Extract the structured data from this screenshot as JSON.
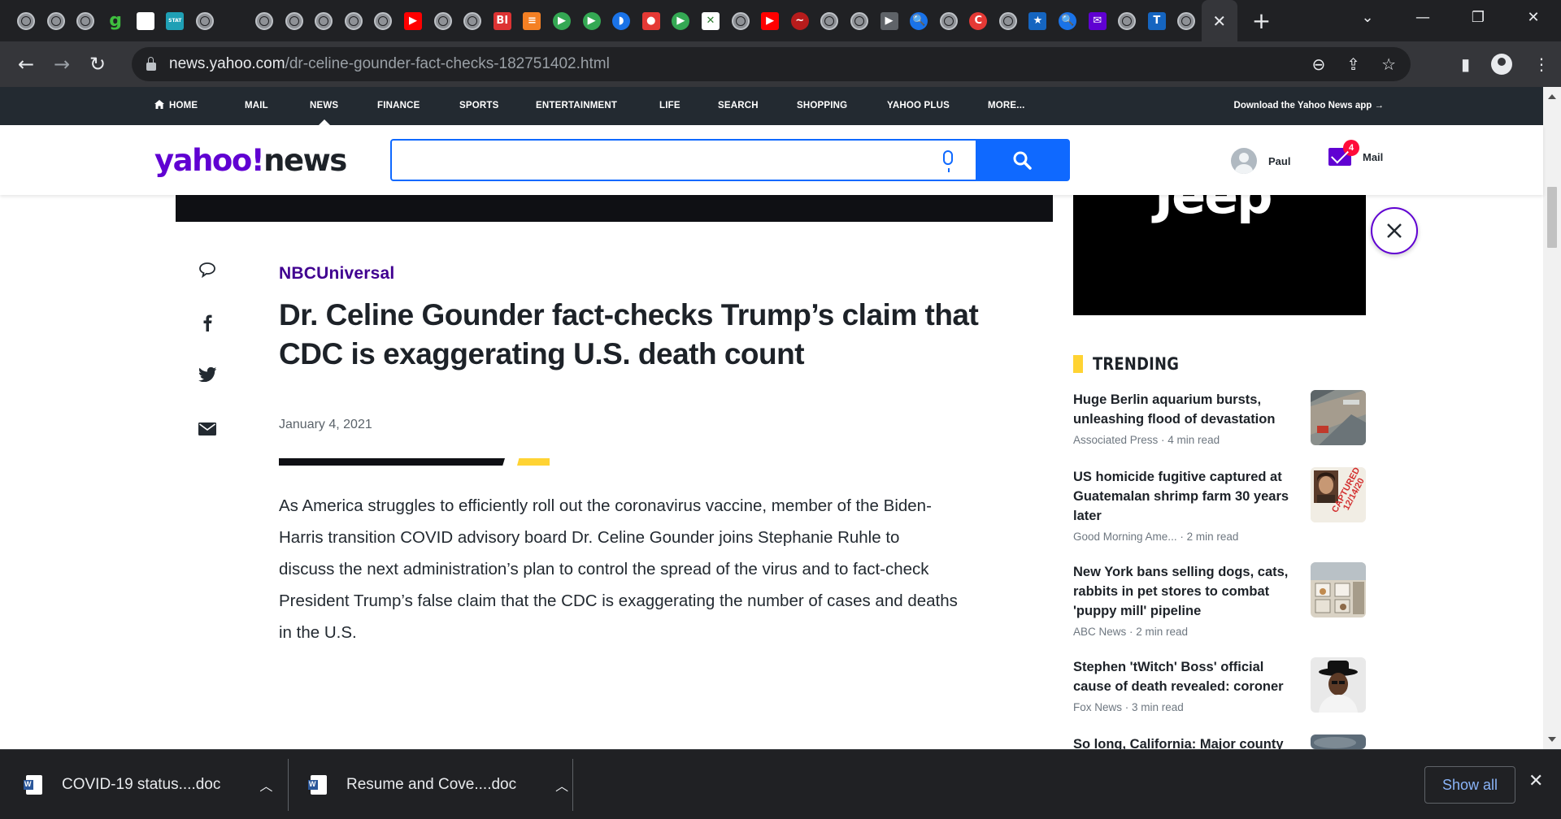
{
  "browser": {
    "tabs": [
      {
        "icon": "globe-icon",
        "kind": "globe"
      },
      {
        "icon": "globe-icon",
        "kind": "globe"
      },
      {
        "icon": "globe-icon",
        "kind": "globe"
      },
      {
        "icon": "g-icon",
        "kind": "letter",
        "glyph": "g",
        "color": "#3fbf3f"
      },
      {
        "icon": "white-square-icon",
        "kind": "square",
        "color": "#ffffff"
      },
      {
        "icon": "stat-icon",
        "kind": "square",
        "color": "#1fa0b5",
        "glyph": "STAT"
      },
      {
        "icon": "globe-icon",
        "kind": "globe"
      },
      {
        "icon": "blank-icon",
        "kind": "blank"
      },
      {
        "icon": "globe-icon",
        "kind": "globe"
      },
      {
        "icon": "globe-icon",
        "kind": "globe"
      },
      {
        "icon": "globe-icon",
        "kind": "globe"
      },
      {
        "icon": "globe-icon",
        "kind": "globe"
      },
      {
        "icon": "globe-icon",
        "kind": "globe"
      },
      {
        "icon": "youtube-icon",
        "kind": "square",
        "color": "#ff0000",
        "glyph": "▶"
      },
      {
        "icon": "globe-icon",
        "kind": "globe"
      },
      {
        "icon": "globe-icon",
        "kind": "globe"
      },
      {
        "icon": "business-insider-icon",
        "kind": "square",
        "color": "#d33",
        "glyph": "BI"
      },
      {
        "icon": "stack-icon",
        "kind": "square",
        "color": "#f48024",
        "glyph": "≡"
      },
      {
        "icon": "play-green-icon",
        "kind": "circle",
        "color": "#34a853",
        "glyph": "▶"
      },
      {
        "icon": "play-green-icon",
        "kind": "circle",
        "color": "#34a853",
        "glyph": "▶"
      },
      {
        "icon": "shield-icon",
        "kind": "circle",
        "color": "#1a73e8",
        "glyph": "◗"
      },
      {
        "icon": "mic-red-icon",
        "kind": "square",
        "color": "#e53935",
        "glyph": "●"
      },
      {
        "icon": "play-green-icon",
        "kind": "circle",
        "color": "#34a853",
        "glyph": "▶"
      },
      {
        "icon": "grid-icon",
        "kind": "square",
        "color": "#ffffff",
        "glyph": "✕"
      },
      {
        "icon": "globe-icon",
        "kind": "globe"
      },
      {
        "icon": "youtube-icon",
        "kind": "square",
        "color": "#ff0000",
        "glyph": "▶"
      },
      {
        "icon": "scribble-icon",
        "kind": "circle",
        "color": "#b71c1c",
        "glyph": "~"
      },
      {
        "icon": "globe-icon",
        "kind": "globe"
      },
      {
        "icon": "globe-icon",
        "kind": "globe"
      },
      {
        "icon": "arrow-badge-icon",
        "kind": "square",
        "color": "#5f6368",
        "glyph": "▶"
      },
      {
        "icon": "search-blue-icon",
        "kind": "circle",
        "color": "#1a73e8",
        "glyph": "🔍"
      },
      {
        "icon": "globe-icon",
        "kind": "globe"
      },
      {
        "icon": "c-red-icon",
        "kind": "circle",
        "color": "#e53935",
        "glyph": "C"
      },
      {
        "icon": "globe-icon",
        "kind": "globe"
      },
      {
        "icon": "flag-icon",
        "kind": "square",
        "color": "#1565c0",
        "glyph": "★"
      },
      {
        "icon": "search-blue-icon",
        "kind": "circle",
        "color": "#1a73e8",
        "glyph": "🔍"
      },
      {
        "icon": "yahoo-mail-icon",
        "kind": "square",
        "color": "#6001d2",
        "glyph": "✉"
      },
      {
        "icon": "globe-icon",
        "kind": "globe"
      },
      {
        "icon": "t-icon",
        "kind": "square",
        "color": "#1565c0",
        "glyph": "T"
      },
      {
        "icon": "globe-icon",
        "kind": "globe"
      }
    ],
    "url_host": "news.yahoo.com",
    "url_path": "/dr-celine-gounder-fact-checks-182751402.html"
  },
  "nav": {
    "items": [
      {
        "label": "HOME",
        "left": 0
      },
      {
        "label": "MAIL"
      },
      {
        "label": "NEWS",
        "active": true
      },
      {
        "label": "FINANCE"
      },
      {
        "label": "SPORTS"
      },
      {
        "label": "ENTERTAINMENT"
      },
      {
        "label": "LIFE"
      },
      {
        "label": "SEARCH"
      },
      {
        "label": "SHOPPING"
      },
      {
        "label": "YAHOO PLUS"
      },
      {
        "label": "MORE..."
      }
    ],
    "download_label": "Download the Yahoo News app"
  },
  "header": {
    "logo_yahoo": "yahoo!",
    "logo_news": "news",
    "search_placeholder": "",
    "user_name": "Paul",
    "mail_label": "Mail",
    "mail_badge": "4"
  },
  "ad": {
    "text": "Jeep"
  },
  "article": {
    "provider": "NBCUniversal",
    "headline": "Dr. Celine Gounder fact-checks Trump’s claim that CDC is exaggerating U.S. death count",
    "date": "January 4, 2021",
    "body": "As America struggles to efficiently roll out the coronavirus vaccine, member of the Biden-Harris transition COVID advisory board Dr. Celine Gounder joins Stephanie Ruhle to discuss the next administration’s plan to control the spread of the virus and to fact-check President Trump’s false claim that the CDC is exaggerating the number of cases and deaths in the U.S."
  },
  "trending": {
    "title": "TRENDING",
    "items": [
      {
        "title": "Huge Berlin aquarium bursts, unleashing flood of devastation",
        "source": "Associated Press",
        "read": "4 min read",
        "thumb": "aerial"
      },
      {
        "title": "US homicide fugitive captured at Guatemalan shrimp farm 30 years later",
        "source": "Good Morning Ame...",
        "read": "2 min read",
        "thumb": "captured"
      },
      {
        "title": "New York bans selling dogs, cats, rabbits in pet stores to combat 'puppy mill' pipeline",
        "source": "ABC News",
        "read": "2 min read",
        "thumb": "store"
      },
      {
        "title": "Stephen 'tWitch' Boss' official cause of death revealed: coroner",
        "source": "Fox News",
        "read": "3 min read",
        "thumb": "portrait"
      },
      {
        "title": "So long, California: Major county",
        "source": "",
        "read": "",
        "thumb": "sky"
      }
    ],
    "thumb_stamp_text": "CAPTURED 12/14/20"
  },
  "downloads": {
    "items": [
      {
        "name": "COVID-19 status....doc"
      },
      {
        "name": "Resume and Cove....doc"
      }
    ],
    "show_all": "Show all"
  },
  "colors": {
    "yahoo_purple": "#6001d2",
    "provider_purple": "#400090",
    "search_blue": "#0f69ff",
    "trending_yellow": "#ffd333"
  }
}
